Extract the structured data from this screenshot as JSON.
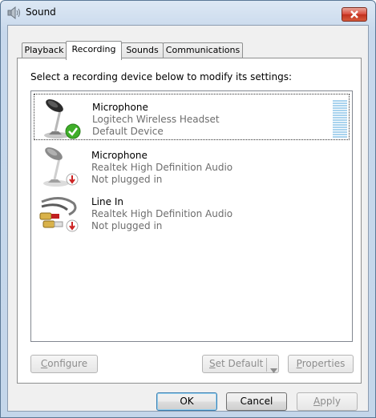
{
  "window": {
    "title": "Sound"
  },
  "tabs": [
    {
      "label": "Playback"
    },
    {
      "label": "Recording"
    },
    {
      "label": "Sounds"
    },
    {
      "label": "Communications"
    }
  ],
  "instruction": "Select a recording device below to modify its settings:",
  "devices": [
    {
      "name": "Microphone",
      "line1": "Logitech Wireless Headset",
      "line2": "Default Device",
      "status_icon": "green-check-icon"
    },
    {
      "name": "Microphone",
      "line1": "Realtek High Definition Audio",
      "line2": "Not plugged in",
      "status_icon": "red-down-arrow-icon"
    },
    {
      "name": "Line In",
      "line1": "Realtek High Definition Audio",
      "line2": "Not plugged in",
      "status_icon": "red-down-arrow-icon"
    }
  ],
  "buttons": {
    "configure": {
      "accel": "C",
      "rest": "onfigure"
    },
    "set_default": {
      "accel": "S",
      "rest": "et Default"
    },
    "properties": {
      "accel": "P",
      "rest": "roperties"
    },
    "ok": "OK",
    "cancel": "Cancel",
    "apply": {
      "accel": "A",
      "rest": "pply"
    }
  },
  "colors": {
    "selection_check": "#3fae29",
    "not_plugged_badge": "#cc2222",
    "level_meter": "#a9d3ee"
  }
}
